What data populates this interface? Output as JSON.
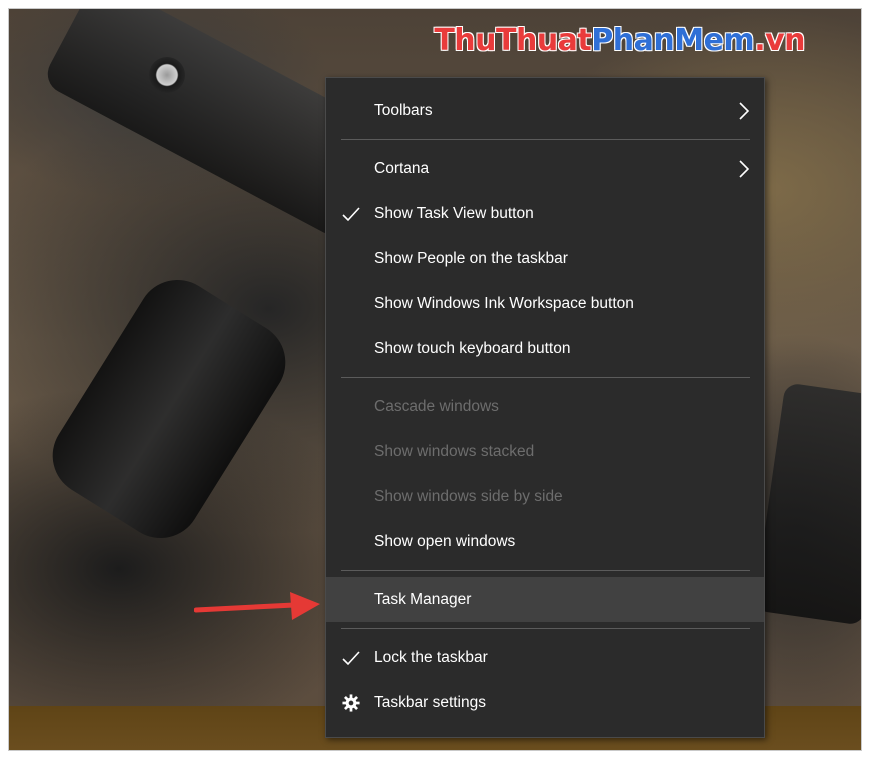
{
  "watermark": {
    "part1": "ThuThuat",
    "part2": "PhanMem",
    "part3": ".vn"
  },
  "menu": {
    "toolbars": "Toolbars",
    "cortana": "Cortana",
    "show_task_view": "Show Task View button",
    "show_people": "Show People on the taskbar",
    "show_ink": "Show Windows Ink Workspace button",
    "show_touch_keyboard": "Show touch keyboard button",
    "cascade": "Cascade windows",
    "stacked": "Show windows stacked",
    "side_by_side": "Show windows side by side",
    "show_open": "Show open windows",
    "task_manager": "Task Manager",
    "lock_taskbar": "Lock the taskbar",
    "taskbar_settings": "Taskbar settings"
  },
  "colors": {
    "menu_bg": "#2b2b2b",
    "hover_bg": "#414141",
    "disabled_text": "#6d6d6d",
    "arrow": "#e53935"
  },
  "icons": {
    "check": "checkmark-icon",
    "submenu": "chevron-right-icon",
    "settings": "gear-icon",
    "annotation": "red-arrow-icon"
  }
}
